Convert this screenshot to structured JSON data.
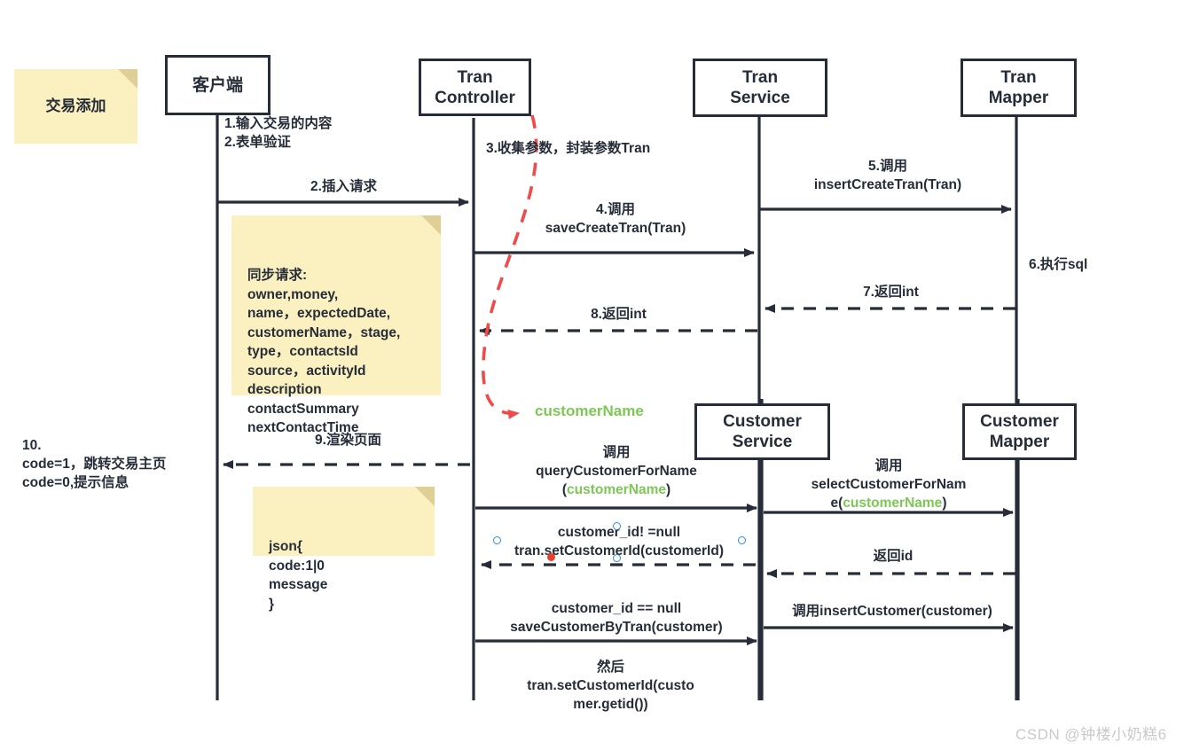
{
  "diagram": {
    "title_note": "交易添加",
    "watermark": "CSDN @钟楼小奶糕6",
    "colors": {
      "stroke": "#262d38",
      "note_fill": "#faf0c0",
      "note_fold": "#dfcf94",
      "highlight_red": "#ee4b4b",
      "highlight_green": "#7dc855",
      "selection_blue": "#2e8be0",
      "selection_red": "#e8402a",
      "watermark_gray": "#c9c9c9"
    }
  },
  "lifelines": [
    {
      "id": "client",
      "label": "客户端"
    },
    {
      "id": "tran-controller",
      "label": "Tran\nController"
    },
    {
      "id": "tran-service",
      "label": "Tran\nService"
    },
    {
      "id": "tran-mapper",
      "label": "Tran\nMapper"
    },
    {
      "id": "customer-service",
      "label": "Customer\nService"
    },
    {
      "id": "customer-mapper",
      "label": "Customer\nMapper"
    }
  ],
  "notes": [
    {
      "id": "title-note",
      "text": "交易添加"
    },
    {
      "id": "sync-request-note",
      "text": "同步请求:\nowner,money,\nname，expectedDate,\ncustomerName，stage,\ntype，contactsId\nsource，activityId\ndescription\ncontactSummary\nnextContactTime"
    },
    {
      "id": "json-response-note",
      "text": "json{\ncode:1|0\nmessage\n}"
    }
  ],
  "messages": [
    {
      "id": "m1",
      "text": "1.输入交易的内容\n2.表单验证"
    },
    {
      "id": "m2",
      "text": "2.插入请求"
    },
    {
      "id": "m3",
      "text": "3.收集参数，封装参数Tran"
    },
    {
      "id": "m4",
      "text": "4.调用\nsaveCreateTran(Tran)"
    },
    {
      "id": "m5",
      "text": "5.调用\ninsertCreateTran(Tran)"
    },
    {
      "id": "m6",
      "text": "6.执行sql"
    },
    {
      "id": "m7",
      "text": "7.返回int"
    },
    {
      "id": "m8",
      "text": "8.返回int"
    },
    {
      "id": "m9",
      "text": "9.渲染页面"
    },
    {
      "id": "m10",
      "text": "10.\ncode=1，跳转交易主页\ncode=0,提示信息"
    },
    {
      "id": "customer-name-ref",
      "text": "customerName"
    },
    {
      "id": "m11",
      "prefix": "调用\nqueryCustomerForName\n(",
      "highlight": "customerName",
      "suffix": ")"
    },
    {
      "id": "m12",
      "prefix": "调用\nselectCustomerForNam\ne(",
      "highlight": "customerName",
      "suffix": ")"
    },
    {
      "id": "m13",
      "text": "customer_id!  =null\ntran.setCustomerId(customerId)"
    },
    {
      "id": "m14",
      "text": "返回id"
    },
    {
      "id": "m15",
      "text": "customer_id == null\nsaveCustomerByTran(customer)"
    },
    {
      "id": "m16",
      "text": "调用insertCustomer(customer)"
    },
    {
      "id": "m17",
      "text": "然后\ntran.setCustomerId(custo\nmer.getid())"
    }
  ]
}
